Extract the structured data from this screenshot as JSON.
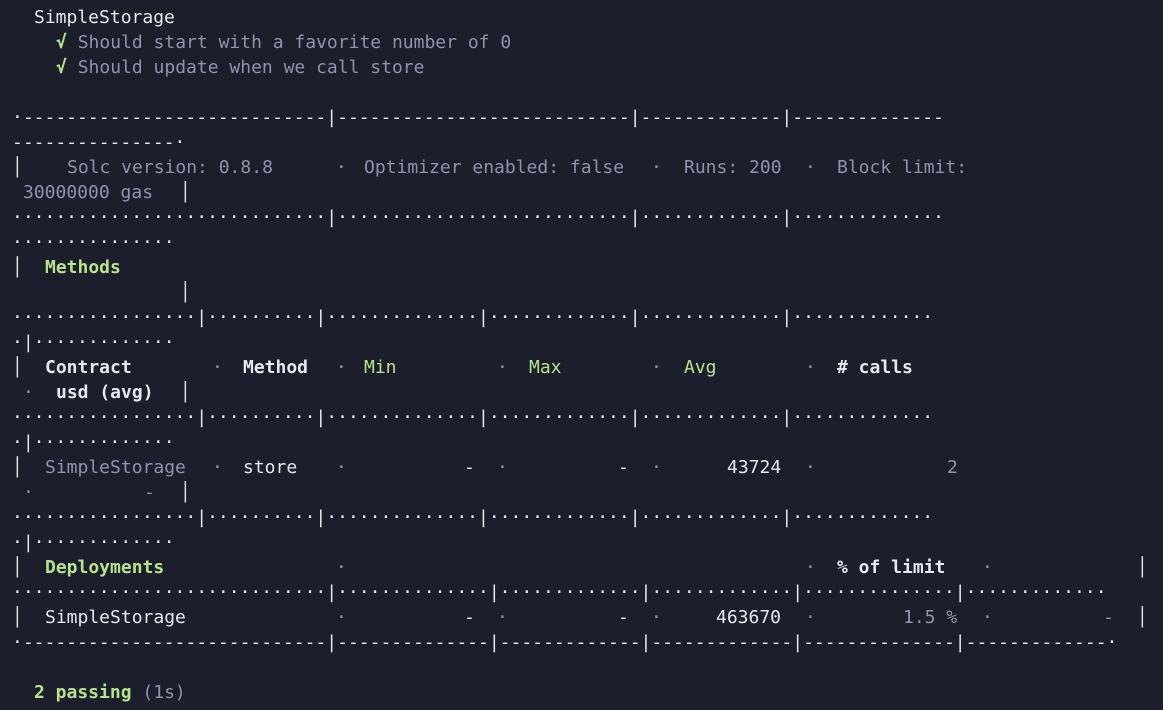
{
  "suite": {
    "title": "SimpleStorage",
    "check": "√",
    "tests": [
      "Should start with a favorite number of 0",
      "Should update when we call store"
    ]
  },
  "table": {
    "borders": {
      "top1": "·----------------------------|---------------------------|-------------|--------------",
      "top2": "---------------·",
      "sep_a1": "·····························|···························|·············|··············",
      "sep_a2": "···············",
      "methods_tail": "│",
      "sep_b1": "·················|··········|··············|·············|·············|·············",
      "sep_b2": "·|·············",
      "sep_c1": "·················|··········|··············|·············|·············|·············",
      "sep_c2": "·|·············",
      "sep_d1": "·················|··········|··············|·············|·············|·············",
      "sep_d2": "·|·············",
      "sep_e": "·····························|··············|·············|·············|··············|·············",
      "bottom": "·----------------------------|--------------|-------------|-------------|--------------|-------------·"
    },
    "header": {
      "solc": "Solc version: 0.8.8",
      "optimizer": "Optimizer enabled: false",
      "runs": "Runs: 200",
      "block_limit": "Block limit:",
      "gas": "30000000 gas"
    },
    "methods_title": "Methods",
    "columns": {
      "contract": "Contract",
      "method": "Method",
      "min": "Min",
      "max": "Max",
      "avg": "Avg",
      "calls": "# calls",
      "usd": "usd (avg)"
    },
    "method_row": {
      "contract": "SimpleStorage",
      "method": "store",
      "min": "-",
      "max": "-",
      "avg": "43724",
      "calls": "2",
      "usd": "-"
    },
    "deployments_title": "Deployments",
    "pct_of_limit": "% of limit",
    "deploy_row": {
      "contract": "SimpleStorage",
      "min": "-",
      "max": "-",
      "avg": "463670",
      "pct": "1.5 %",
      "usd": "-"
    }
  },
  "summary": {
    "passing": "2 passing",
    "duration": "(1s)"
  }
}
